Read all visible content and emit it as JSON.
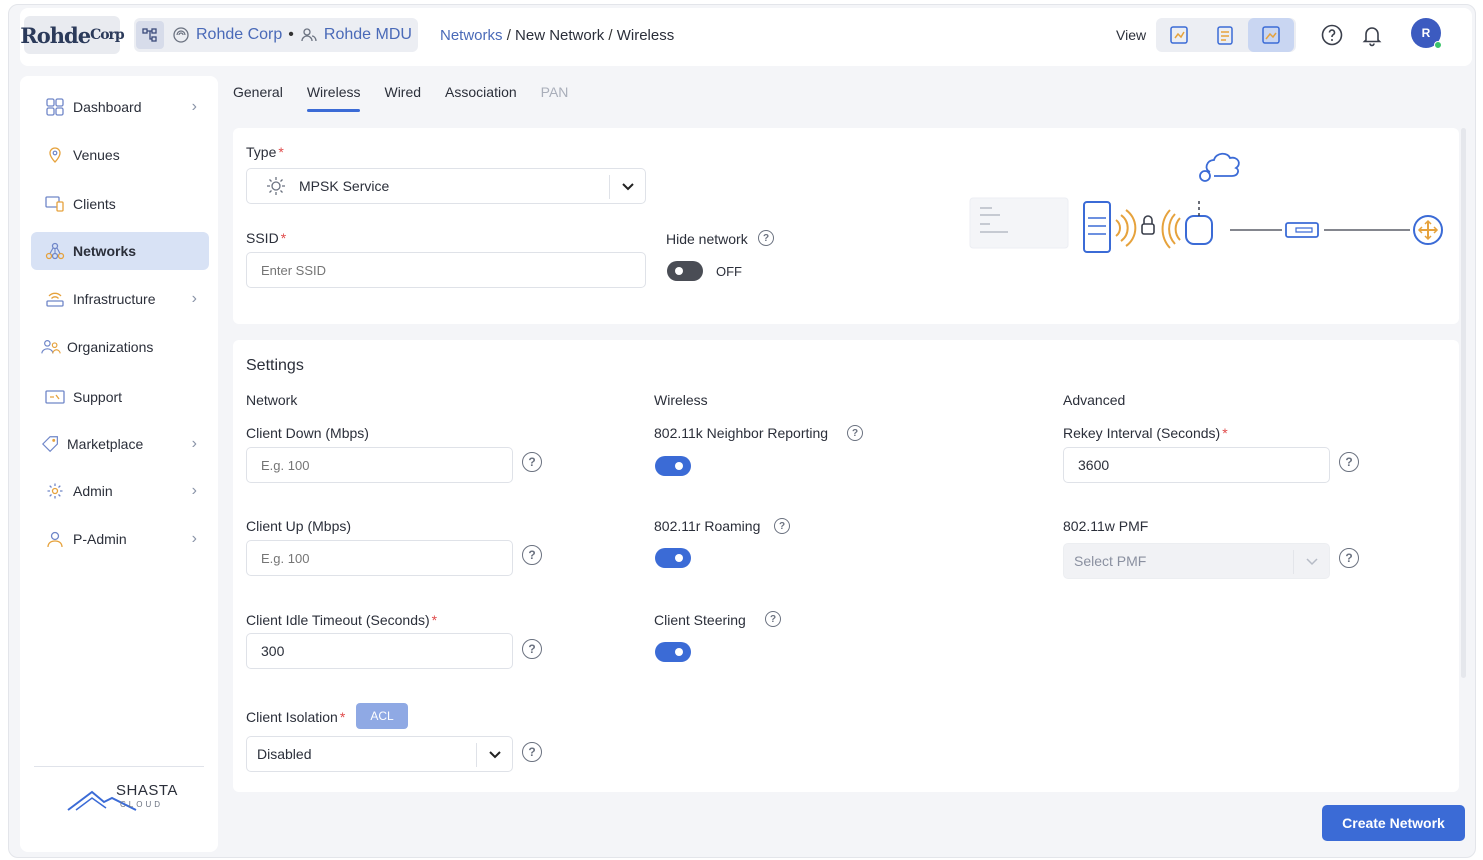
{
  "header": {
    "logo_text": "Rohde",
    "logo_suffix": "Corp",
    "org_icon": "sitemap-icon",
    "org_name": "Rohde Corp",
    "separator": "•",
    "site_name": "Rohde MDU",
    "breadcrumb": {
      "link": "Networks",
      "rest1": "New Network",
      "rest2": "Wireless"
    },
    "view_label": "View",
    "avatar_initial": "R"
  },
  "sidebar": {
    "items": [
      {
        "label": "Dashboard",
        "icon": "dashboard-icon",
        "has_chevron": true
      },
      {
        "label": "Venues",
        "icon": "location-pin-icon",
        "has_chevron": false
      },
      {
        "label": "Clients",
        "icon": "devices-icon",
        "has_chevron": false
      },
      {
        "label": "Networks",
        "icon": "network-icon",
        "has_chevron": false,
        "active": true
      },
      {
        "label": "Infrastructure",
        "icon": "wifi-router-icon",
        "has_chevron": true
      },
      {
        "label": "Organizations",
        "icon": "users-icon",
        "has_chevron": false
      },
      {
        "label": "Support",
        "icon": "support-icon",
        "has_chevron": false
      },
      {
        "label": "Marketplace",
        "icon": "tag-icon",
        "has_chevron": true
      },
      {
        "label": "Admin",
        "icon": "gear-icon",
        "has_chevron": true
      },
      {
        "label": "P-Admin",
        "icon": "user-icon",
        "has_chevron": true
      }
    ],
    "brand": "SHASTA",
    "brand_sub": "CLOUD"
  },
  "tabs": [
    {
      "label": "General"
    },
    {
      "label": "Wireless",
      "active": true
    },
    {
      "label": "Wired"
    },
    {
      "label": "Association"
    },
    {
      "label": "PAN",
      "disabled": true
    }
  ],
  "basic": {
    "type_label": "Type",
    "type_value": "MPSK Service",
    "ssid_label": "SSID",
    "ssid_placeholder": "Enter SSID",
    "hide_network_label": "Hide network",
    "hide_network_state": "OFF"
  },
  "settings": {
    "title": "Settings",
    "network": {
      "heading": "Network",
      "client_down_label": "Client Down (Mbps)",
      "client_down_placeholder": "E.g. 100",
      "client_up_label": "Client Up (Mbps)",
      "client_up_placeholder": "E.g. 100",
      "idle_timeout_label": "Client Idle Timeout (Seconds)",
      "idle_timeout_value": "300",
      "isolation_label": "Client Isolation",
      "acl_label": "ACL",
      "isolation_value": "Disabled"
    },
    "wireless": {
      "heading": "Wireless",
      "neighbor_label": "802.11k Neighbor Reporting",
      "roaming_label": "802.11r Roaming",
      "steering_label": "Client Steering"
    },
    "advanced": {
      "heading": "Advanced",
      "rekey_label": "Rekey Interval (Seconds)",
      "rekey_value": "3600",
      "pmf_label": "802.11w PMF",
      "pmf_placeholder": "Select PMF"
    }
  },
  "help_glyph": "?",
  "create_button": "Create Network",
  "colors": {
    "accent": "#3b6bd6",
    "link": "#4a6ab8",
    "required": "#e04b4b",
    "active_nav": "#d8e2f5"
  }
}
